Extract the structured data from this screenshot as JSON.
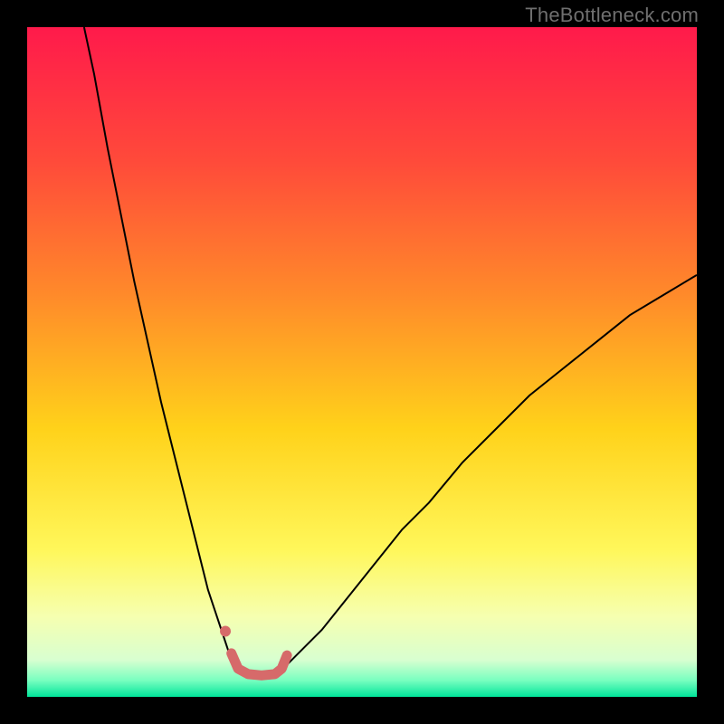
{
  "watermark": "TheBottleneck.com",
  "chart_data": {
    "type": "line",
    "title": "",
    "xlabel": "",
    "ylabel": "",
    "xlim": [
      0,
      100
    ],
    "ylim": [
      0,
      100
    ],
    "grid": false,
    "legend": false,
    "background_gradient": {
      "stops": [
        {
          "offset": 0.0,
          "color": "#ff1a4b"
        },
        {
          "offset": 0.2,
          "color": "#ff4a3a"
        },
        {
          "offset": 0.4,
          "color": "#ff8a2a"
        },
        {
          "offset": 0.6,
          "color": "#ffd21a"
        },
        {
          "offset": 0.78,
          "color": "#fff75a"
        },
        {
          "offset": 0.88,
          "color": "#f6ffb0"
        },
        {
          "offset": 0.945,
          "color": "#d8ffd0"
        },
        {
          "offset": 0.975,
          "color": "#7affc0"
        },
        {
          "offset": 1.0,
          "color": "#00e59a"
        }
      ]
    },
    "series": [
      {
        "name": "left-branch",
        "stroke": "#000000",
        "stroke_width": 2,
        "x": [
          8.5,
          10,
          12,
          14,
          16,
          18,
          20,
          22,
          24,
          26,
          27,
          28,
          29,
          30,
          31,
          32
        ],
        "y": [
          100,
          93,
          82,
          72,
          62,
          53,
          44,
          36,
          28,
          20,
          16,
          13,
          10,
          7,
          5,
          4
        ]
      },
      {
        "name": "right-branch",
        "stroke": "#000000",
        "stroke_width": 2,
        "x": [
          38,
          40,
          44,
          48,
          52,
          56,
          60,
          65,
          70,
          75,
          80,
          85,
          90,
          95,
          100
        ],
        "y": [
          4,
          6,
          10,
          15,
          20,
          25,
          29,
          35,
          40,
          45,
          49,
          53,
          57,
          60,
          63
        ]
      },
      {
        "name": "bottom-flat",
        "stroke": "#d66a6a",
        "stroke_width": 11,
        "linecap": "round",
        "x": [
          30.5,
          31.5,
          33,
          35,
          37,
          38,
          38.8
        ],
        "y": [
          6.5,
          4.2,
          3.4,
          3.2,
          3.4,
          4.2,
          6.2
        ]
      },
      {
        "name": "left-dot",
        "type": "scatter",
        "fill": "#d66a6a",
        "radius": 6,
        "x": [
          29.6
        ],
        "y": [
          9.8
        ]
      }
    ]
  }
}
